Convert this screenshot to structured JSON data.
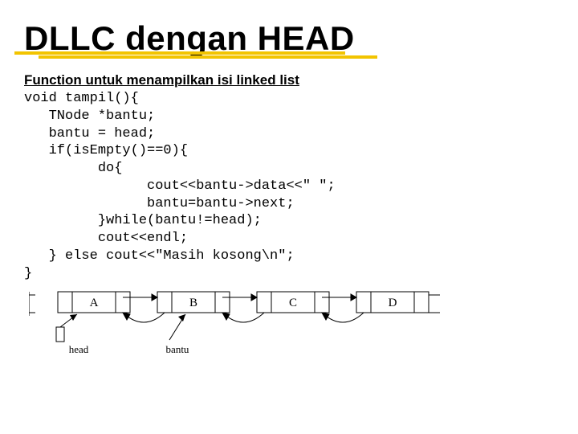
{
  "title": "DLLC dengan HEAD",
  "subtitle": "Function untuk menampilkan isi linked list",
  "code": "void tampil(){\n   TNode *bantu;\n   bantu = head;\n   if(isEmpty()==0){\n         do{\n               cout<<bantu->data<<\" \";\n               bantu=bantu->next;\n         }while(bantu!=head);\n         cout<<endl;\n   } else cout<<\"Masih kosong\\n\";\n}",
  "diagram": {
    "nodes": [
      "A",
      "B",
      "C",
      "D"
    ],
    "labels": {
      "head": "head",
      "bantu": "bantu"
    }
  }
}
